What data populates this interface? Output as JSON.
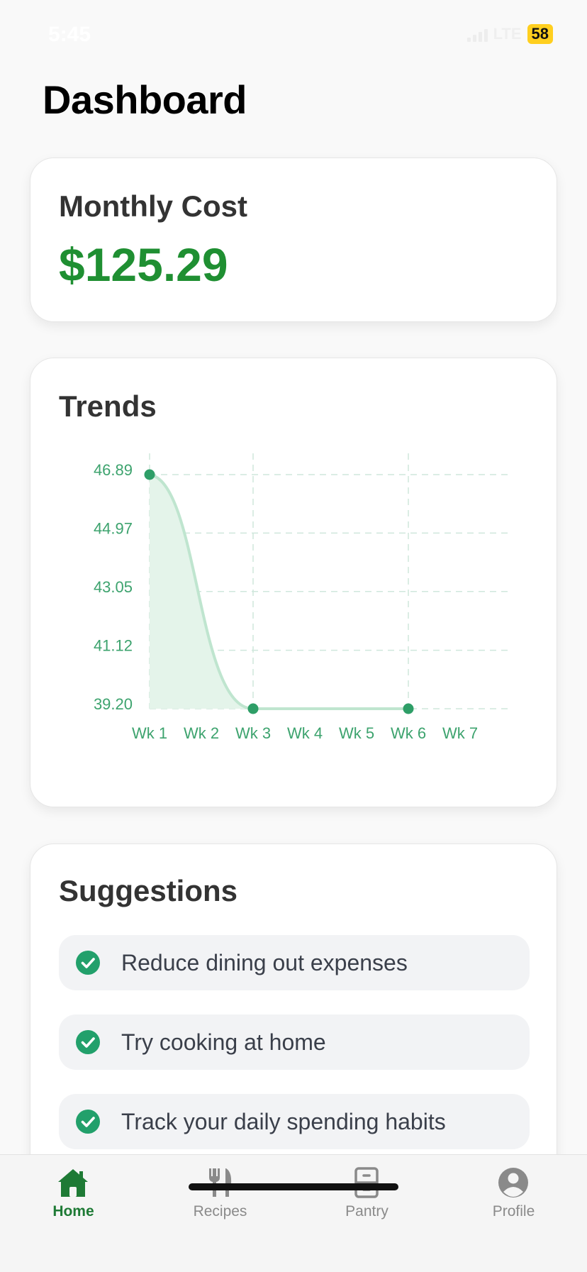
{
  "status_bar": {
    "time": "5:45",
    "network": "LTE",
    "battery": "58"
  },
  "page": {
    "title": "Dashboard"
  },
  "monthly_cost": {
    "title": "Monthly Cost",
    "value": "$125.29",
    "value_color": "#1f8f32"
  },
  "trends": {
    "title": "Trends",
    "chart_data": {
      "type": "area",
      "categories": [
        "Wk 1",
        "Wk 2",
        "Wk 3",
        "Wk 4",
        "Wk 5",
        "Wk 6",
        "Wk 7"
      ],
      "y_ticks": [
        "46.89",
        "44.97",
        "43.05",
        "41.12",
        "39.20"
      ],
      "ylim": [
        39.2,
        46.89
      ],
      "points": [
        {
          "x": "Wk 1",
          "y": 46.89
        },
        {
          "x": "Wk 3",
          "y": 39.2
        },
        {
          "x": "Wk 6",
          "y": 39.2
        }
      ],
      "line_color": "#bfe5cf",
      "fill_color": "#e4f4ea",
      "marker_color": "#2e9e67",
      "grid": true
    }
  },
  "suggestions": {
    "title": "Suggestions",
    "items": [
      {
        "label": "Reduce dining out expenses"
      },
      {
        "label": "Try cooking at home"
      },
      {
        "label": "Track your daily spending habits"
      }
    ],
    "check_color": "#22a06b"
  },
  "tab_bar": {
    "tabs": [
      {
        "label": "Home",
        "icon": "home-icon",
        "active": true
      },
      {
        "label": "Recipes",
        "icon": "fork-knife-icon",
        "active": false
      },
      {
        "label": "Pantry",
        "icon": "cabinet-icon",
        "active": false
      },
      {
        "label": "Profile",
        "icon": "user-circle-icon",
        "active": false
      }
    ],
    "active_color": "#1e7a35",
    "inactive_color": "#8a8a8a"
  }
}
